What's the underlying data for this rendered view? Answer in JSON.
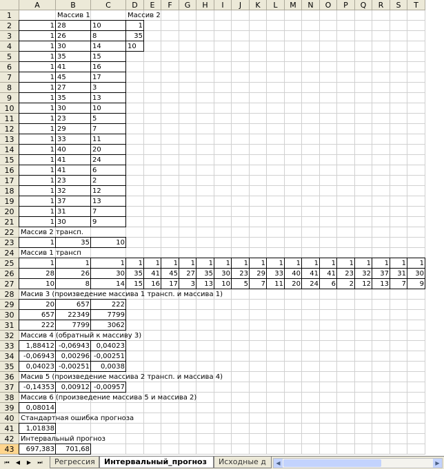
{
  "columns": [
    "A",
    "B",
    "C",
    "D",
    "E",
    "F",
    "G",
    "H",
    "I",
    "J",
    "K",
    "L",
    "M",
    "N",
    "O",
    "P",
    "Q",
    "R",
    "S",
    "T"
  ],
  "selected_row": "43",
  "cells": [
    {
      "r": 1,
      "c": 1,
      "v": "Массив 1",
      "a": "l"
    },
    {
      "r": 1,
      "c": 3,
      "v": "Массив 2",
      "a": "l"
    },
    {
      "r": 2,
      "c": 0,
      "v": "1",
      "a": "r"
    },
    {
      "r": 2,
      "c": 1,
      "v": "28",
      "a": "l"
    },
    {
      "r": 2,
      "c": 2,
      "v": "10",
      "a": "l"
    },
    {
      "r": 2,
      "c": 3,
      "v": "1",
      "a": "r"
    },
    {
      "r": 3,
      "c": 0,
      "v": "1",
      "a": "r"
    },
    {
      "r": 3,
      "c": 1,
      "v": "26",
      "a": "l"
    },
    {
      "r": 3,
      "c": 2,
      "v": "8",
      "a": "l"
    },
    {
      "r": 3,
      "c": 3,
      "v": "35",
      "a": "r"
    },
    {
      "r": 4,
      "c": 0,
      "v": "1",
      "a": "r"
    },
    {
      "r": 4,
      "c": 1,
      "v": "30",
      "a": "l"
    },
    {
      "r": 4,
      "c": 2,
      "v": "14",
      "a": "l"
    },
    {
      "r": 4,
      "c": 3,
      "v": "10",
      "a": "l"
    },
    {
      "r": 5,
      "c": 0,
      "v": "1",
      "a": "r"
    },
    {
      "r": 5,
      "c": 1,
      "v": "35",
      "a": "l"
    },
    {
      "r": 5,
      "c": 2,
      "v": "15",
      "a": "l"
    },
    {
      "r": 6,
      "c": 0,
      "v": "1",
      "a": "r"
    },
    {
      "r": 6,
      "c": 1,
      "v": "41",
      "a": "l"
    },
    {
      "r": 6,
      "c": 2,
      "v": "16",
      "a": "l"
    },
    {
      "r": 7,
      "c": 0,
      "v": "1",
      "a": "r"
    },
    {
      "r": 7,
      "c": 1,
      "v": "45",
      "a": "l"
    },
    {
      "r": 7,
      "c": 2,
      "v": "17",
      "a": "l"
    },
    {
      "r": 8,
      "c": 0,
      "v": "1",
      "a": "r"
    },
    {
      "r": 8,
      "c": 1,
      "v": "27",
      "a": "l"
    },
    {
      "r": 8,
      "c": 2,
      "v": "3",
      "a": "l"
    },
    {
      "r": 9,
      "c": 0,
      "v": "1",
      "a": "r"
    },
    {
      "r": 9,
      "c": 1,
      "v": "35",
      "a": "l"
    },
    {
      "r": 9,
      "c": 2,
      "v": "13",
      "a": "l"
    },
    {
      "r": 10,
      "c": 0,
      "v": "1",
      "a": "r"
    },
    {
      "r": 10,
      "c": 1,
      "v": "30",
      "a": "l"
    },
    {
      "r": 10,
      "c": 2,
      "v": "10",
      "a": "l"
    },
    {
      "r": 11,
      "c": 0,
      "v": "1",
      "a": "r"
    },
    {
      "r": 11,
      "c": 1,
      "v": "23",
      "a": "l"
    },
    {
      "r": 11,
      "c": 2,
      "v": "5",
      "a": "l"
    },
    {
      "r": 12,
      "c": 0,
      "v": "1",
      "a": "r"
    },
    {
      "r": 12,
      "c": 1,
      "v": "29",
      "a": "l"
    },
    {
      "r": 12,
      "c": 2,
      "v": "7",
      "a": "l"
    },
    {
      "r": 13,
      "c": 0,
      "v": "1",
      "a": "r"
    },
    {
      "r": 13,
      "c": 1,
      "v": "33",
      "a": "l"
    },
    {
      "r": 13,
      "c": 2,
      "v": "11",
      "a": "l"
    },
    {
      "r": 14,
      "c": 0,
      "v": "1",
      "a": "r"
    },
    {
      "r": 14,
      "c": 1,
      "v": "40",
      "a": "l"
    },
    {
      "r": 14,
      "c": 2,
      "v": "20",
      "a": "l"
    },
    {
      "r": 15,
      "c": 0,
      "v": "1",
      "a": "r"
    },
    {
      "r": 15,
      "c": 1,
      "v": "41",
      "a": "l"
    },
    {
      "r": 15,
      "c": 2,
      "v": "24",
      "a": "l"
    },
    {
      "r": 16,
      "c": 0,
      "v": "1",
      "a": "r"
    },
    {
      "r": 16,
      "c": 1,
      "v": "41",
      "a": "l"
    },
    {
      "r": 16,
      "c": 2,
      "v": "6",
      "a": "l"
    },
    {
      "r": 17,
      "c": 0,
      "v": "1",
      "a": "r"
    },
    {
      "r": 17,
      "c": 1,
      "v": "23",
      "a": "l"
    },
    {
      "r": 17,
      "c": 2,
      "v": "2",
      "a": "l"
    },
    {
      "r": 18,
      "c": 0,
      "v": "1",
      "a": "r"
    },
    {
      "r": 18,
      "c": 1,
      "v": "32",
      "a": "l"
    },
    {
      "r": 18,
      "c": 2,
      "v": "12",
      "a": "l"
    },
    {
      "r": 19,
      "c": 0,
      "v": "1",
      "a": "r"
    },
    {
      "r": 19,
      "c": 1,
      "v": "37",
      "a": "l"
    },
    {
      "r": 19,
      "c": 2,
      "v": "13",
      "a": "l"
    },
    {
      "r": 20,
      "c": 0,
      "v": "1",
      "a": "r"
    },
    {
      "r": 20,
      "c": 1,
      "v": "31",
      "a": "l"
    },
    {
      "r": 20,
      "c": 2,
      "v": "7",
      "a": "l"
    },
    {
      "r": 21,
      "c": 0,
      "v": "1",
      "a": "r"
    },
    {
      "r": 21,
      "c": 1,
      "v": "30",
      "a": "l"
    },
    {
      "r": 21,
      "c": 2,
      "v": "9",
      "a": "l"
    },
    {
      "r": 22,
      "c": 0,
      "v": "Массив 2 трансп.",
      "a": "l"
    },
    {
      "r": 23,
      "c": 0,
      "v": "1",
      "a": "r"
    },
    {
      "r": 23,
      "c": 1,
      "v": "35",
      "a": "r"
    },
    {
      "r": 23,
      "c": 2,
      "v": "10",
      "a": "r"
    },
    {
      "r": 24,
      "c": 0,
      "v": "Массив 1 трансп",
      "a": "l"
    },
    {
      "r": 25,
      "c": 0,
      "v": "1",
      "a": "r"
    },
    {
      "r": 25,
      "c": 1,
      "v": "1",
      "a": "r"
    },
    {
      "r": 25,
      "c": 2,
      "v": "1",
      "a": "r"
    },
    {
      "r": 25,
      "c": 3,
      "v": "1",
      "a": "r"
    },
    {
      "r": 25,
      "c": 4,
      "v": "1",
      "a": "r"
    },
    {
      "r": 25,
      "c": 5,
      "v": "1",
      "a": "r"
    },
    {
      "r": 25,
      "c": 6,
      "v": "1",
      "a": "r"
    },
    {
      "r": 25,
      "c": 7,
      "v": "1",
      "a": "r"
    },
    {
      "r": 25,
      "c": 8,
      "v": "1",
      "a": "r"
    },
    {
      "r": 25,
      "c": 9,
      "v": "1",
      "a": "r"
    },
    {
      "r": 25,
      "c": 10,
      "v": "1",
      "a": "r"
    },
    {
      "r": 25,
      "c": 11,
      "v": "1",
      "a": "r"
    },
    {
      "r": 25,
      "c": 12,
      "v": "1",
      "a": "r"
    },
    {
      "r": 25,
      "c": 13,
      "v": "1",
      "a": "r"
    },
    {
      "r": 25,
      "c": 14,
      "v": "1",
      "a": "r"
    },
    {
      "r": 25,
      "c": 15,
      "v": "1",
      "a": "r"
    },
    {
      "r": 25,
      "c": 16,
      "v": "1",
      "a": "r"
    },
    {
      "r": 25,
      "c": 17,
      "v": "1",
      "a": "r"
    },
    {
      "r": 25,
      "c": 18,
      "v": "1",
      "a": "r"
    },
    {
      "r": 25,
      "c": 19,
      "v": "1",
      "a": "r"
    },
    {
      "r": 26,
      "c": 0,
      "v": "28",
      "a": "r"
    },
    {
      "r": 26,
      "c": 1,
      "v": "26",
      "a": "r"
    },
    {
      "r": 26,
      "c": 2,
      "v": "30",
      "a": "r"
    },
    {
      "r": 26,
      "c": 3,
      "v": "35",
      "a": "r"
    },
    {
      "r": 26,
      "c": 4,
      "v": "41",
      "a": "r"
    },
    {
      "r": 26,
      "c": 5,
      "v": "45",
      "a": "r"
    },
    {
      "r": 26,
      "c": 6,
      "v": "27",
      "a": "r"
    },
    {
      "r": 26,
      "c": 7,
      "v": "35",
      "a": "r"
    },
    {
      "r": 26,
      "c": 8,
      "v": "30",
      "a": "r"
    },
    {
      "r": 26,
      "c": 9,
      "v": "23",
      "a": "r"
    },
    {
      "r": 26,
      "c": 10,
      "v": "29",
      "a": "r"
    },
    {
      "r": 26,
      "c": 11,
      "v": "33",
      "a": "r"
    },
    {
      "r": 26,
      "c": 12,
      "v": "40",
      "a": "r"
    },
    {
      "r": 26,
      "c": 13,
      "v": "41",
      "a": "r"
    },
    {
      "r": 26,
      "c": 14,
      "v": "41",
      "a": "r"
    },
    {
      "r": 26,
      "c": 15,
      "v": "23",
      "a": "r"
    },
    {
      "r": 26,
      "c": 16,
      "v": "32",
      "a": "r"
    },
    {
      "r": 26,
      "c": 17,
      "v": "37",
      "a": "r"
    },
    {
      "r": 26,
      "c": 18,
      "v": "31",
      "a": "r"
    },
    {
      "r": 26,
      "c": 19,
      "v": "30",
      "a": "r"
    },
    {
      "r": 27,
      "c": 0,
      "v": "10",
      "a": "r"
    },
    {
      "r": 27,
      "c": 1,
      "v": "8",
      "a": "r"
    },
    {
      "r": 27,
      "c": 2,
      "v": "14",
      "a": "r"
    },
    {
      "r": 27,
      "c": 3,
      "v": "15",
      "a": "r"
    },
    {
      "r": 27,
      "c": 4,
      "v": "16",
      "a": "r"
    },
    {
      "r": 27,
      "c": 5,
      "v": "17",
      "a": "r"
    },
    {
      "r": 27,
      "c": 6,
      "v": "3",
      "a": "r"
    },
    {
      "r": 27,
      "c": 7,
      "v": "13",
      "a": "r"
    },
    {
      "r": 27,
      "c": 8,
      "v": "10",
      "a": "r"
    },
    {
      "r": 27,
      "c": 9,
      "v": "5",
      "a": "r"
    },
    {
      "r": 27,
      "c": 10,
      "v": "7",
      "a": "r"
    },
    {
      "r": 27,
      "c": 11,
      "v": "11",
      "a": "r"
    },
    {
      "r": 27,
      "c": 12,
      "v": "20",
      "a": "r"
    },
    {
      "r": 27,
      "c": 13,
      "v": "24",
      "a": "r"
    },
    {
      "r": 27,
      "c": 14,
      "v": "6",
      "a": "r"
    },
    {
      "r": 27,
      "c": 15,
      "v": "2",
      "a": "r"
    },
    {
      "r": 27,
      "c": 16,
      "v": "12",
      "a": "r"
    },
    {
      "r": 27,
      "c": 17,
      "v": "13",
      "a": "r"
    },
    {
      "r": 27,
      "c": 18,
      "v": "7",
      "a": "r"
    },
    {
      "r": 27,
      "c": 19,
      "v": "9",
      "a": "r"
    },
    {
      "r": 28,
      "c": 0,
      "v": "Масив 3 (произведение массива 1 трансп. и массива 1)",
      "a": "l"
    },
    {
      "r": 29,
      "c": 0,
      "v": "20",
      "a": "r"
    },
    {
      "r": 29,
      "c": 1,
      "v": "657",
      "a": "r"
    },
    {
      "r": 29,
      "c": 2,
      "v": "222",
      "a": "r"
    },
    {
      "r": 30,
      "c": 0,
      "v": "657",
      "a": "r"
    },
    {
      "r": 30,
      "c": 1,
      "v": "22349",
      "a": "r"
    },
    {
      "r": 30,
      "c": 2,
      "v": "7799",
      "a": "r"
    },
    {
      "r": 31,
      "c": 0,
      "v": "222",
      "a": "r"
    },
    {
      "r": 31,
      "c": 1,
      "v": "7799",
      "a": "r"
    },
    {
      "r": 31,
      "c": 2,
      "v": "3062",
      "a": "r"
    },
    {
      "r": 32,
      "c": 0,
      "v": "Массив 4 (обратный к массиву 3)",
      "a": "l"
    },
    {
      "r": 33,
      "c": 0,
      "v": "1,88412",
      "a": "r"
    },
    {
      "r": 33,
      "c": 1,
      "v": "-0,06943",
      "a": "r"
    },
    {
      "r": 33,
      "c": 2,
      "v": "0,04023",
      "a": "r"
    },
    {
      "r": 34,
      "c": 0,
      "v": "-0,06943",
      "a": "r"
    },
    {
      "r": 34,
      "c": 1,
      "v": "0,00296",
      "a": "r"
    },
    {
      "r": 34,
      "c": 2,
      "v": "-0,00251",
      "a": "r"
    },
    {
      "r": 35,
      "c": 0,
      "v": "0,04023",
      "a": "r"
    },
    {
      "r": 35,
      "c": 1,
      "v": "-0,00251",
      "a": "r"
    },
    {
      "r": 35,
      "c": 2,
      "v": "0,0038",
      "a": "r"
    },
    {
      "r": 36,
      "c": 0,
      "v": "Масив 5 (произведение массива 2 трансп. и массива 4)",
      "a": "l"
    },
    {
      "r": 37,
      "c": 0,
      "v": "-0,14353",
      "a": "r"
    },
    {
      "r": 37,
      "c": 1,
      "v": "0,00912",
      "a": "r"
    },
    {
      "r": 37,
      "c": 2,
      "v": "-0,00957",
      "a": "r"
    },
    {
      "r": 38,
      "c": 0,
      "v": "Массив 6 (произведение массива 5 и массива 2)",
      "a": "l"
    },
    {
      "r": 39,
      "c": 0,
      "v": "0,08014",
      "a": "r"
    },
    {
      "r": 40,
      "c": 0,
      "v": "Стандартная ошибка прогноза",
      "a": "l"
    },
    {
      "r": 41,
      "c": 0,
      "v": "1,01838",
      "a": "r"
    },
    {
      "r": 42,
      "c": 0,
      "v": "Интервальный прогноз",
      "a": "l"
    },
    {
      "r": 43,
      "c": 0,
      "v": "697,383",
      "a": "r"
    },
    {
      "r": 43,
      "c": 1,
      "v": "701,68",
      "a": "r"
    }
  ],
  "borders": [
    {
      "r1": 2,
      "r2": 21,
      "c1": 0,
      "c2": 2
    },
    {
      "r1": 2,
      "r2": 4,
      "c1": 3,
      "c2": 3
    },
    {
      "r1": 23,
      "r2": 23,
      "c1": 0,
      "c2": 2
    },
    {
      "r1": 25,
      "r2": 27,
      "c1": 0,
      "c2": 19
    },
    {
      "r1": 29,
      "r2": 31,
      "c1": 0,
      "c2": 2
    },
    {
      "r1": 33,
      "r2": 35,
      "c1": 0,
      "c2": 2
    },
    {
      "r1": 37,
      "r2": 37,
      "c1": 0,
      "c2": 2
    },
    {
      "r1": 39,
      "r2": 39,
      "c1": 0,
      "c2": 0
    },
    {
      "r1": 41,
      "r2": 41,
      "c1": 0,
      "c2": 0
    },
    {
      "r1": 43,
      "r2": 43,
      "c1": 0,
      "c2": 1
    }
  ],
  "tabs": {
    "nav": [
      "⏮",
      "◀",
      "▶",
      "⏭"
    ],
    "sheets": [
      {
        "label": "Регрессия",
        "active": false
      },
      {
        "label": "Интервальный_прогноз",
        "active": true
      },
      {
        "label": "Исходные д",
        "active": false
      }
    ]
  },
  "scrollbar": {
    "left": "◀",
    "right": "▶"
  }
}
